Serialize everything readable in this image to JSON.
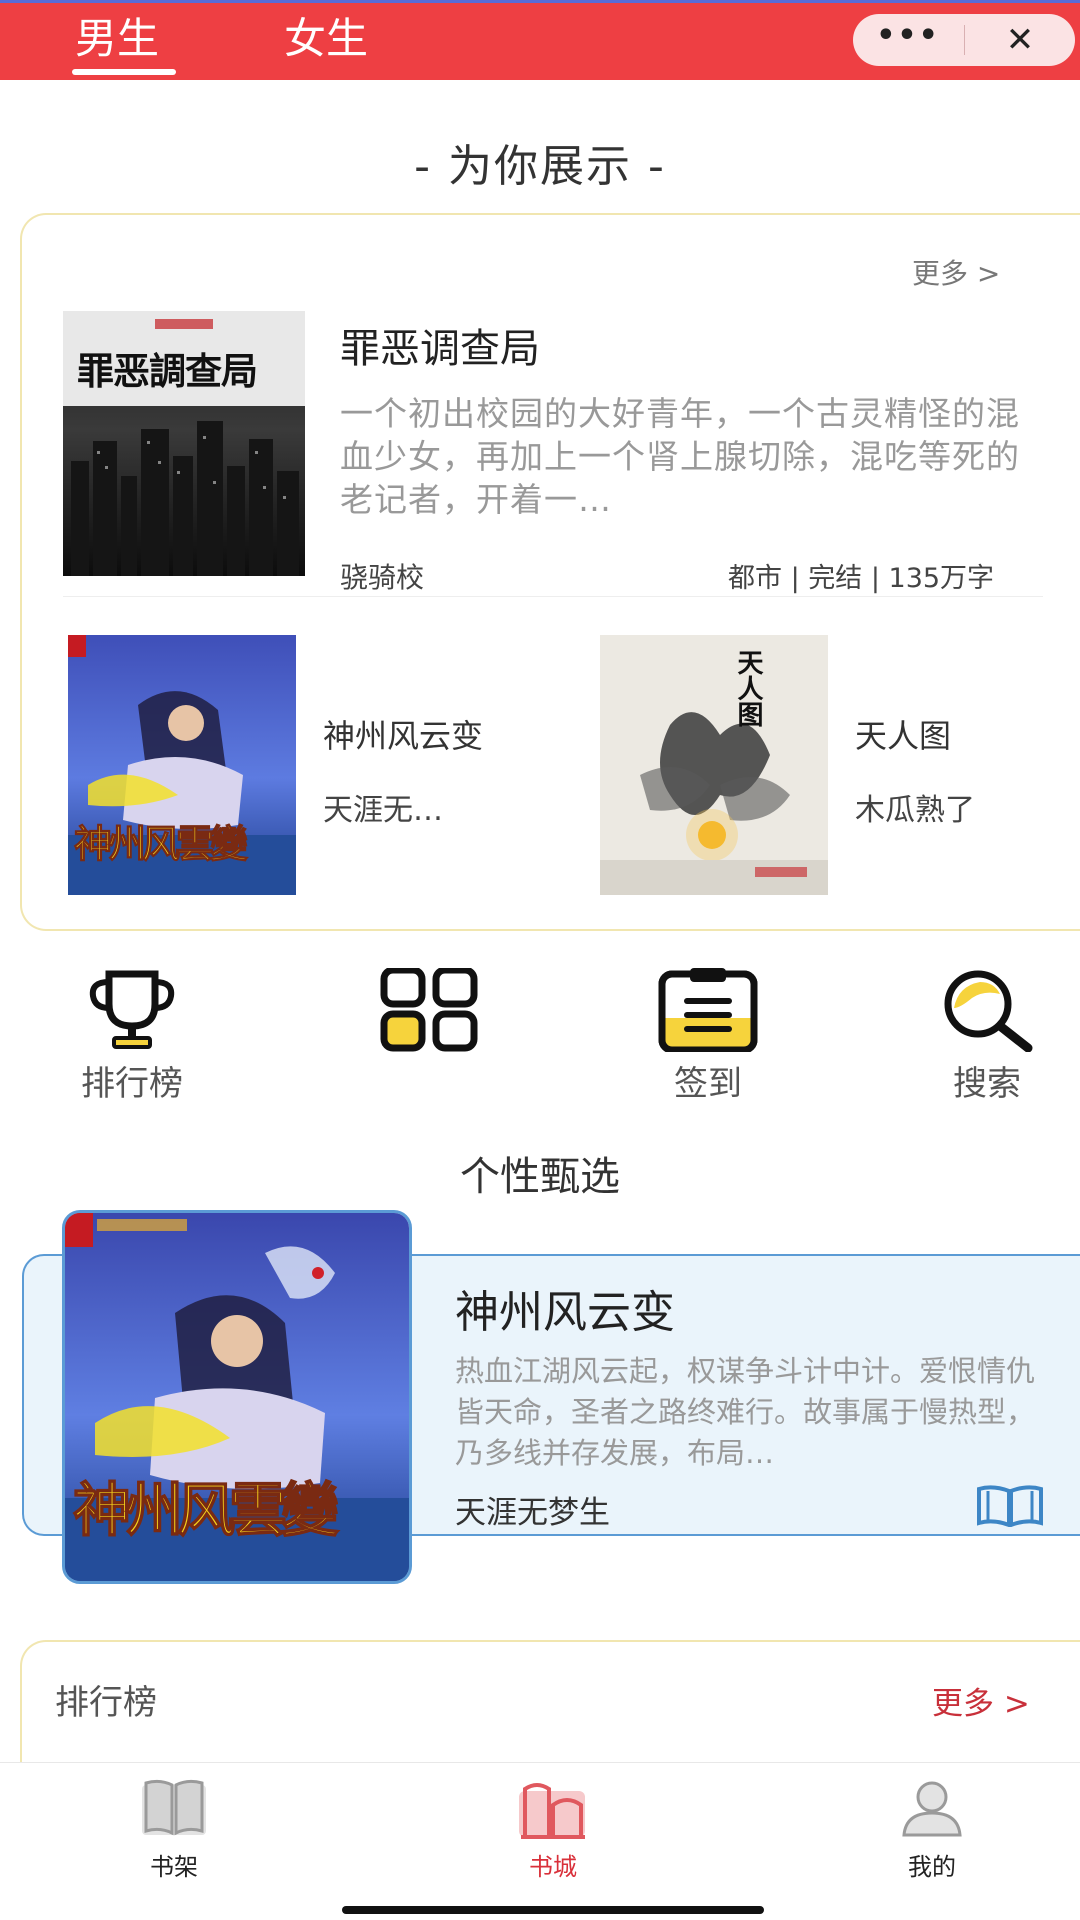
{
  "header": {
    "tabs": [
      {
        "label": "男生",
        "active": true
      },
      {
        "label": "女生",
        "active": false
      }
    ],
    "capsule": {
      "more_icon": "more-dots-icon",
      "close_icon": "close-icon"
    },
    "accent_color": "#ee3f43"
  },
  "showcase": {
    "title": "- 为你展示 -",
    "more_label": "更多 >",
    "featured": {
      "title": "罪恶调查局",
      "description": "一个初出校园的大好青年，一个古灵精怪的混血少女，再加上一个肾上腺切除，混吃等死的老记者，开着一…",
      "author": "骁骑校",
      "meta": "都市 | 完结 | 135万字",
      "cover_text": "罪恶調查局"
    },
    "books": [
      {
        "title": "神州风云变",
        "author": "天涯无…",
        "cover_text": "神州风雲變"
      },
      {
        "title": "天人图",
        "author": "木瓜熟了",
        "cover_text": "天人图"
      }
    ]
  },
  "quick_nav": [
    {
      "label": "排行榜",
      "icon": "trophy-icon"
    },
    {
      "label": "",
      "icon": "grid-icon"
    },
    {
      "label": "签到",
      "icon": "clipboard-icon"
    },
    {
      "label": "搜索",
      "icon": "search-icon"
    }
  ],
  "personal_pick": {
    "section_title": "个性甄选",
    "title": "神州风云变",
    "description": "热血江湖风云起，权谋争斗计中计。爱恨情仇皆天命，圣者之路终难行。故事属于慢热型，乃多线并存发展，布局…",
    "author": "天涯无梦生",
    "read_icon": "open-book-icon"
  },
  "ranking": {
    "title": "排行榜",
    "more_label": "更多 >"
  },
  "bottom_nav": [
    {
      "label": "书架",
      "icon": "bookshelf-icon",
      "active": false
    },
    {
      "label": "书城",
      "icon": "bookstore-icon",
      "active": true
    },
    {
      "label": "我的",
      "icon": "user-icon",
      "active": false
    }
  ]
}
